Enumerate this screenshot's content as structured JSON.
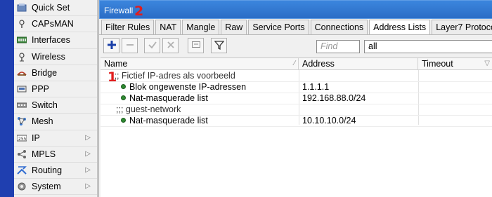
{
  "sidebar": {
    "items": [
      {
        "label": "Quick Set",
        "icon": "quick-set-icon"
      },
      {
        "label": "CAPsMAN",
        "icon": "capsman-icon"
      },
      {
        "label": "Interfaces",
        "icon": "interfaces-icon"
      },
      {
        "label": "Wireless",
        "icon": "wireless-icon"
      },
      {
        "label": "Bridge",
        "icon": "bridge-icon"
      },
      {
        "label": "PPP",
        "icon": "ppp-icon"
      },
      {
        "label": "Switch",
        "icon": "switch-icon"
      },
      {
        "label": "Mesh",
        "icon": "mesh-icon"
      },
      {
        "label": "IP",
        "icon": "ip-icon",
        "submenu": true
      },
      {
        "label": "MPLS",
        "icon": "mpls-icon",
        "submenu": true
      },
      {
        "label": "Routing",
        "icon": "routing-icon",
        "submenu": true
      },
      {
        "label": "System",
        "icon": "system-icon",
        "submenu": true
      }
    ],
    "submenu_arrow": "▷"
  },
  "window": {
    "title": "Firewall"
  },
  "annotations": {
    "marker_1": "1",
    "marker_2": "2",
    "color": "#e11d1d"
  },
  "tabs": [
    {
      "label": "Filter Rules",
      "active": false
    },
    {
      "label": "NAT",
      "active": false
    },
    {
      "label": "Mangle",
      "active": false
    },
    {
      "label": "Raw",
      "active": false
    },
    {
      "label": "Service Ports",
      "active": false
    },
    {
      "label": "Connections",
      "active": false
    },
    {
      "label": "Address Lists",
      "active": true
    },
    {
      "label": "Layer7 Protocols",
      "active": false
    }
  ],
  "toolbar": {
    "buttons": [
      {
        "name": "add-button",
        "icon": "plus-icon"
      },
      {
        "name": "remove-button",
        "icon": "minus-icon"
      },
      {
        "name": "enable-button",
        "icon": "check-icon"
      },
      {
        "name": "disable-button",
        "icon": "x-icon"
      },
      {
        "name": "comment-button",
        "icon": "comment-icon"
      },
      {
        "name": "filter-button",
        "icon": "funnel-icon"
      }
    ],
    "find_placeholder": "Find",
    "filter_value": "all"
  },
  "table": {
    "columns": [
      "Name",
      "Address",
      "Timeout"
    ],
    "rows": [
      {
        "type": "comment",
        "text": ";;; Fictief IP-adres als voorbeeld"
      },
      {
        "type": "entry",
        "name": "Blok ongewenste IP-adressen",
        "address": "1.1.1.1",
        "timeout": "",
        "status_color": "#2f8b32"
      },
      {
        "type": "entry",
        "name": "Nat-masquerade list",
        "address": "192.168.88.0/24",
        "timeout": "",
        "status_color": "#2f8b32"
      },
      {
        "type": "comment",
        "text": ";;; guest-network"
      },
      {
        "type": "entry",
        "name": "Nat-masquerade list",
        "address": "10.10.10.0/24",
        "timeout": "",
        "status_color": "#2f8b32"
      }
    ]
  },
  "colors": {
    "accent": "#1f3fb0",
    "titlebar": "#2b6dc6",
    "toolbar_add": "#1a3fa8"
  }
}
